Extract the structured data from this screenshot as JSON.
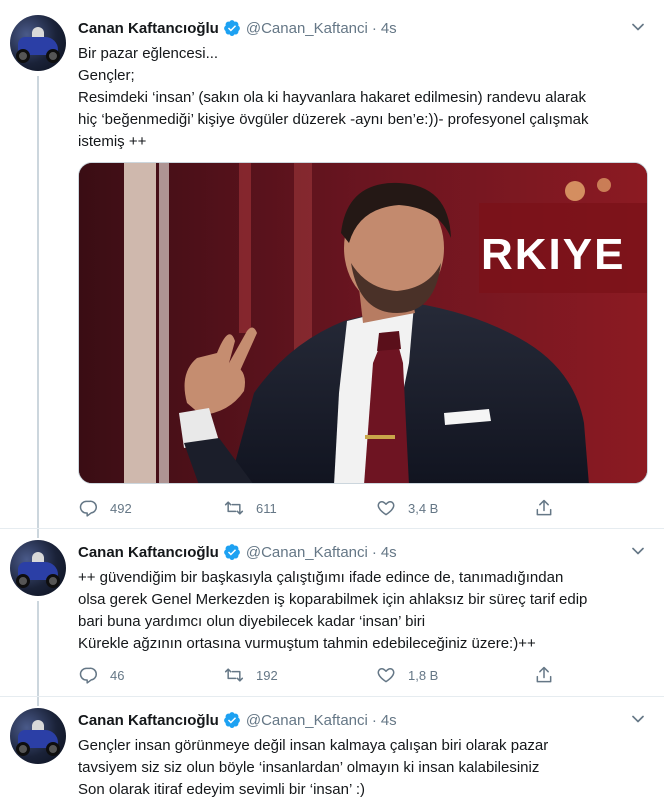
{
  "tweets": [
    {
      "name": "Canan Kaftancıoğlu",
      "handle": "@Canan_Kaftanci",
      "dot": "·",
      "time": "4s",
      "lines": [
        "Bir pazar eğlencesi...",
        "Gençler;",
        "Resimdeki ‘insan’ (sakın ola ki hayvanlara hakaret edilmesin) randevu alarak",
        "hiç ‘beğenmediği’ kişiye övgüler düzerek -aynı ben’e:))- profesyonel çalışmak",
        "istemiş ++"
      ],
      "replies": "492",
      "retweets": "611",
      "likes": "3,4 B"
    },
    {
      "name": "Canan Kaftancıoğlu",
      "handle": "@Canan_Kaftanci",
      "dot": "·",
      "time": "4s",
      "lines": [
        "++ güvendiğim bir başkasıyla çalıştığımı ifade edince de, tanımadığından",
        "olsa gerek Genel Merkezden iş koparabilmek için  ahlaksız bir süreç tarif edip",
        "bari buna yardımcı olun diyebilecek kadar ‘insan’ biri",
        "Kürekle ağzının ortasına vurmuştum tahmin edebileceğiniz üzere:)++"
      ],
      "replies": "46",
      "retweets": "192",
      "likes": "1,8 B"
    },
    {
      "name": "Canan Kaftancıoğlu",
      "handle": "@Canan_Kaftanci",
      "dot": "·",
      "time": "4s",
      "lines": [
        "Gençler insan görünmeye değil insan kalmaya çalışan biri olarak pazar",
        "tavsiyem siz siz olun böyle ‘insanlardan’ olmayın ki insan kalabilesiniz",
        "Son olarak itiraf edeyim sevimli bir ‘insan’ :)"
      ]
    }
  ],
  "media": {
    "backdrop_text": "RKIYE"
  },
  "icons": {
    "reply": "reply-icon",
    "retweet": "retweet-icon",
    "like": "like-icon",
    "share": "share-icon",
    "verified": "verified-badge-icon",
    "more": "chevron-down-icon"
  },
  "colors": {
    "text": "#14171a",
    "secondary": "#657786",
    "verified": "#1da1f2",
    "thread_line": "#ccd6dd"
  }
}
